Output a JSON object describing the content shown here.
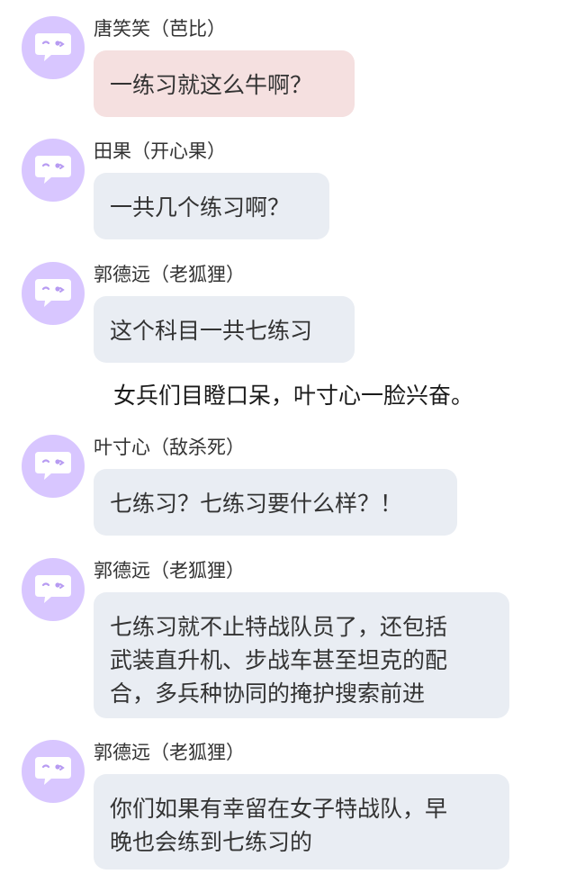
{
  "messages": [
    {
      "sender": "唐笑笑（芭比）",
      "text": "一练习就这么牛啊？"
    },
    {
      "sender": "田果（开心果）",
      "text": "一共几个练习啊？"
    },
    {
      "sender": "郭德远（老狐狸）",
      "text": "这个科目一共七练习"
    },
    {
      "sender": "叶寸心（敌杀死）",
      "text": "七练习？七练习要什么样？！"
    },
    {
      "sender": "郭德远（老狐狸）",
      "text": "七练习就不止特战队员了，还包括\n武装直升机、步战车甚至坦克的配\n合，多兵种协同的掩护搜索前进"
    },
    {
      "sender": "郭德远（老狐狸）",
      "text": "你们如果有幸留在女子特战队，早\n晚也会练到七练习的"
    }
  ],
  "narration": "女兵们目瞪口呆，叶寸心一脸兴奋。",
  "colors": {
    "avatar_bg": "#d8c6ff",
    "avatar_bubble": "#ffffff",
    "avatar_eye": "#b79bf2",
    "bubble_default": "#e9edf3",
    "bubble_highlight": "#f5e0e0"
  },
  "icons": {
    "avatar": "chat-bubble-face-icon"
  }
}
